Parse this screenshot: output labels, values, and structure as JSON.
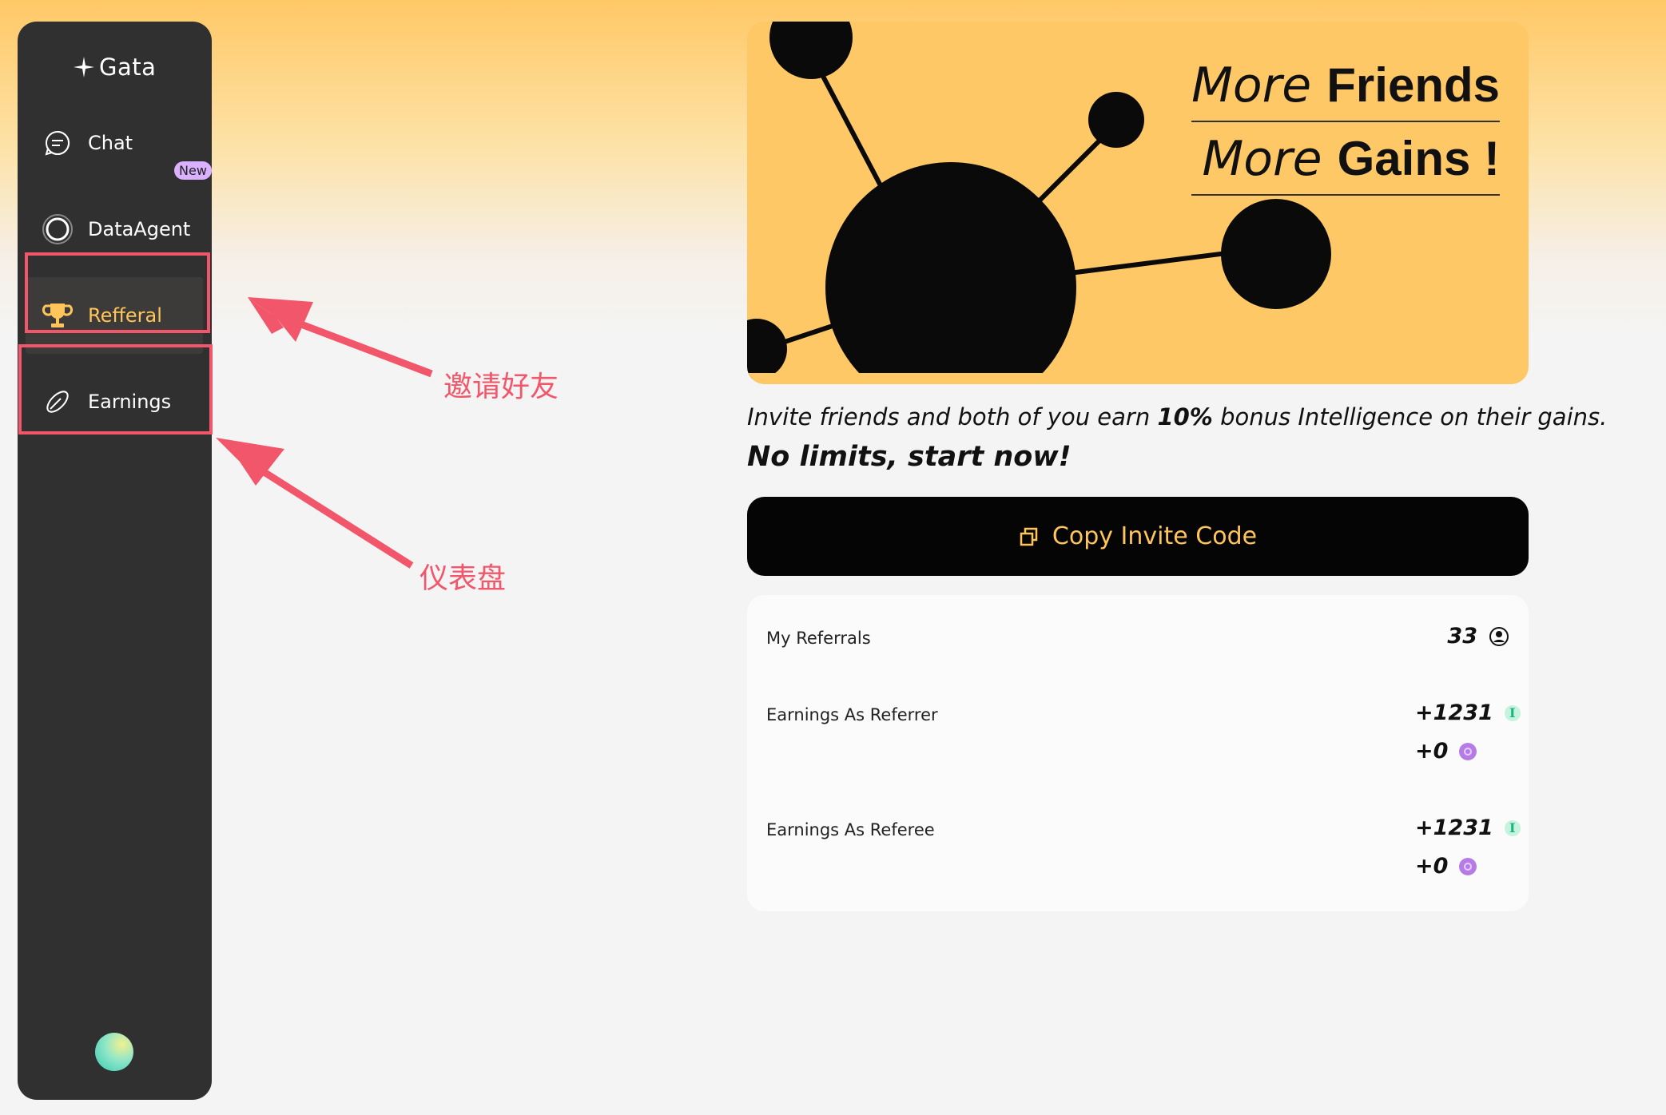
{
  "sidebar": {
    "logo": "Gata",
    "items": [
      {
        "label": "Chat"
      },
      {
        "label": "DataAgent",
        "badge": "New"
      },
      {
        "label": "Refferal"
      },
      {
        "label": "Earnings"
      }
    ]
  },
  "annotations": {
    "referral": "邀请好友",
    "earnings": "仪表盘"
  },
  "banner": {
    "line1_light": "More",
    "line1_heavy": "Friends",
    "line2_light": "More",
    "line2_heavy": "Gains !"
  },
  "invite": {
    "prefix": "Invite friends and both of you earn ",
    "bonus": "10%",
    "suffix": " bonus Intelligence on their gains.",
    "cta": "No limits, start now!"
  },
  "copy_button": "Copy Invite Code",
  "stats": {
    "referrals_label": "My Referrals",
    "referrals_value": "33",
    "referrer_label": "Earnings As Referrer",
    "referrer_intel": "+1231",
    "referrer_points": "+0",
    "referee_label": "Earnings As Referee",
    "referee_intel": "+1231",
    "referee_points": "+0"
  },
  "colors": {
    "accent": "#ffc55a",
    "sidebar_bg": "#303030",
    "annotation": "#f2566a",
    "banner_bg": "#ffc866"
  }
}
